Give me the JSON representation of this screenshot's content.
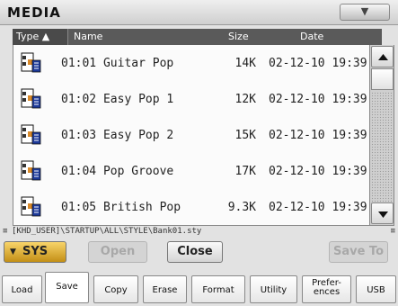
{
  "window": {
    "title": "MEDIA",
    "menu_icon": "triangle-down"
  },
  "columns": {
    "type": "Type ▲",
    "name": "Name",
    "size": "Size",
    "date": "Date"
  },
  "files": [
    {
      "icon": "style-file-icon",
      "name": "01:01 Guitar Pop",
      "size": "14K",
      "date": "02-12-10 19:39"
    },
    {
      "icon": "style-file-icon",
      "name": "01:02 Easy Pop 1",
      "size": "12K",
      "date": "02-12-10 19:39"
    },
    {
      "icon": "style-file-icon",
      "name": "01:03 Easy Pop 2",
      "size": "15K",
      "date": "02-12-10 19:39"
    },
    {
      "icon": "style-file-icon",
      "name": "01:04 Pop Groove",
      "size": "17K",
      "date": "02-12-10 19:39"
    },
    {
      "icon": "style-file-icon",
      "name": "01:05 British Pop",
      "size": "9.3K",
      "date": "02-12-10 19:39"
    }
  ],
  "path": {
    "text": "[KHD_USER]\\STARTUP\\ALL\\STYLE\\Bank01.sty",
    "marker": "≡"
  },
  "buttons": {
    "device": "SYS",
    "open": "Open",
    "close": "Close",
    "save_to": "Save To"
  },
  "tabs": [
    {
      "label": "Load"
    },
    {
      "label": "Save"
    },
    {
      "label": "Copy"
    },
    {
      "label": "Erase"
    },
    {
      "label": "Format"
    },
    {
      "label": "Utility"
    },
    {
      "label": "Prefer-\nences"
    },
    {
      "label": "USB"
    }
  ],
  "active_tab": "Save",
  "colors": {
    "accent": "#e0a62a",
    "header": "#5a5a5a",
    "list_bg": "#fbfbfb"
  }
}
